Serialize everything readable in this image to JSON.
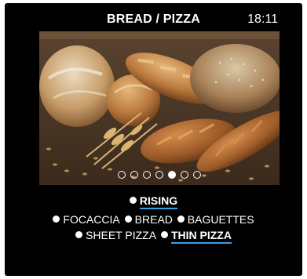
{
  "header": {
    "title": "BREAD / PIZZA",
    "time": "18:11"
  },
  "carousel": {
    "image": "bread-loaves-and-wheat-photo",
    "total_pages": 7,
    "active_page": 5
  },
  "programs": {
    "rising": "RISING",
    "focaccia": "FOCACCIA",
    "bread": "BREAD",
    "baguettes": "BAGUETTES",
    "sheet_pizza": "SHEET PIZZA",
    "thin_pizza": "THIN PIZZA"
  },
  "colors": {
    "selection_underline": "#3aa0e8",
    "background": "#000000",
    "text": "#ffffff"
  }
}
